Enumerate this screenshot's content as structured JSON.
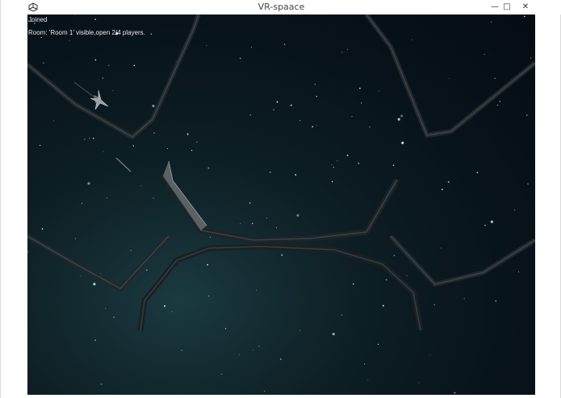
{
  "window": {
    "title": "VR-spaace",
    "icon": "unity-icon",
    "controls": {
      "minimize": "minimize-icon",
      "maximize": "maximize-icon",
      "close": "close-icon"
    }
  },
  "hud": {
    "status": "Joined",
    "room_info": "Room: 'Room 1' visible,open 2/4 players."
  },
  "colors": {
    "space_dark": "#050c12",
    "space_teal": "#17343a",
    "track_edge": "#2b3236",
    "hud_text": "#e8e8e8"
  }
}
